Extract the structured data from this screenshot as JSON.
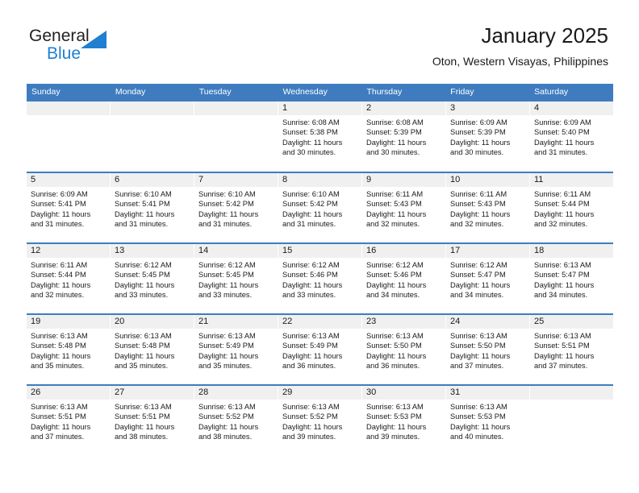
{
  "brand": {
    "name_part1": "General",
    "name_part2": "Blue",
    "triangle_color": "#1f7fd0",
    "text_color": "#231f20"
  },
  "header": {
    "title": "January 2025",
    "subtitle": "Oton, Western Visayas, Philippines"
  },
  "theme": {
    "header_blue": "#3f7cbf",
    "day_band_gray": "#f0f0f0",
    "text": "#1a1a1a"
  },
  "weekdays": [
    "Sunday",
    "Monday",
    "Tuesday",
    "Wednesday",
    "Thursday",
    "Friday",
    "Saturday"
  ],
  "weeks": [
    [
      {
        "empty": true
      },
      {
        "empty": true
      },
      {
        "empty": true
      },
      {
        "day": "1",
        "sunrise": "Sunrise: 6:08 AM",
        "sunset": "Sunset: 5:38 PM",
        "daylight1": "Daylight: 11 hours",
        "daylight2": "and 30 minutes."
      },
      {
        "day": "2",
        "sunrise": "Sunrise: 6:08 AM",
        "sunset": "Sunset: 5:39 PM",
        "daylight1": "Daylight: 11 hours",
        "daylight2": "and 30 minutes."
      },
      {
        "day": "3",
        "sunrise": "Sunrise: 6:09 AM",
        "sunset": "Sunset: 5:39 PM",
        "daylight1": "Daylight: 11 hours",
        "daylight2": "and 30 minutes."
      },
      {
        "day": "4",
        "sunrise": "Sunrise: 6:09 AM",
        "sunset": "Sunset: 5:40 PM",
        "daylight1": "Daylight: 11 hours",
        "daylight2": "and 31 minutes."
      }
    ],
    [
      {
        "day": "5",
        "sunrise": "Sunrise: 6:09 AM",
        "sunset": "Sunset: 5:41 PM",
        "daylight1": "Daylight: 11 hours",
        "daylight2": "and 31 minutes."
      },
      {
        "day": "6",
        "sunrise": "Sunrise: 6:10 AM",
        "sunset": "Sunset: 5:41 PM",
        "daylight1": "Daylight: 11 hours",
        "daylight2": "and 31 minutes."
      },
      {
        "day": "7",
        "sunrise": "Sunrise: 6:10 AM",
        "sunset": "Sunset: 5:42 PM",
        "daylight1": "Daylight: 11 hours",
        "daylight2": "and 31 minutes."
      },
      {
        "day": "8",
        "sunrise": "Sunrise: 6:10 AM",
        "sunset": "Sunset: 5:42 PM",
        "daylight1": "Daylight: 11 hours",
        "daylight2": "and 31 minutes."
      },
      {
        "day": "9",
        "sunrise": "Sunrise: 6:11 AM",
        "sunset": "Sunset: 5:43 PM",
        "daylight1": "Daylight: 11 hours",
        "daylight2": "and 32 minutes."
      },
      {
        "day": "10",
        "sunrise": "Sunrise: 6:11 AM",
        "sunset": "Sunset: 5:43 PM",
        "daylight1": "Daylight: 11 hours",
        "daylight2": "and 32 minutes."
      },
      {
        "day": "11",
        "sunrise": "Sunrise: 6:11 AM",
        "sunset": "Sunset: 5:44 PM",
        "daylight1": "Daylight: 11 hours",
        "daylight2": "and 32 minutes."
      }
    ],
    [
      {
        "day": "12",
        "sunrise": "Sunrise: 6:11 AM",
        "sunset": "Sunset: 5:44 PM",
        "daylight1": "Daylight: 11 hours",
        "daylight2": "and 32 minutes."
      },
      {
        "day": "13",
        "sunrise": "Sunrise: 6:12 AM",
        "sunset": "Sunset: 5:45 PM",
        "daylight1": "Daylight: 11 hours",
        "daylight2": "and 33 minutes."
      },
      {
        "day": "14",
        "sunrise": "Sunrise: 6:12 AM",
        "sunset": "Sunset: 5:45 PM",
        "daylight1": "Daylight: 11 hours",
        "daylight2": "and 33 minutes."
      },
      {
        "day": "15",
        "sunrise": "Sunrise: 6:12 AM",
        "sunset": "Sunset: 5:46 PM",
        "daylight1": "Daylight: 11 hours",
        "daylight2": "and 33 minutes."
      },
      {
        "day": "16",
        "sunrise": "Sunrise: 6:12 AM",
        "sunset": "Sunset: 5:46 PM",
        "daylight1": "Daylight: 11 hours",
        "daylight2": "and 34 minutes."
      },
      {
        "day": "17",
        "sunrise": "Sunrise: 6:12 AM",
        "sunset": "Sunset: 5:47 PM",
        "daylight1": "Daylight: 11 hours",
        "daylight2": "and 34 minutes."
      },
      {
        "day": "18",
        "sunrise": "Sunrise: 6:13 AM",
        "sunset": "Sunset: 5:47 PM",
        "daylight1": "Daylight: 11 hours",
        "daylight2": "and 34 minutes."
      }
    ],
    [
      {
        "day": "19",
        "sunrise": "Sunrise: 6:13 AM",
        "sunset": "Sunset: 5:48 PM",
        "daylight1": "Daylight: 11 hours",
        "daylight2": "and 35 minutes."
      },
      {
        "day": "20",
        "sunrise": "Sunrise: 6:13 AM",
        "sunset": "Sunset: 5:48 PM",
        "daylight1": "Daylight: 11 hours",
        "daylight2": "and 35 minutes."
      },
      {
        "day": "21",
        "sunrise": "Sunrise: 6:13 AM",
        "sunset": "Sunset: 5:49 PM",
        "daylight1": "Daylight: 11 hours",
        "daylight2": "and 35 minutes."
      },
      {
        "day": "22",
        "sunrise": "Sunrise: 6:13 AM",
        "sunset": "Sunset: 5:49 PM",
        "daylight1": "Daylight: 11 hours",
        "daylight2": "and 36 minutes."
      },
      {
        "day": "23",
        "sunrise": "Sunrise: 6:13 AM",
        "sunset": "Sunset: 5:50 PM",
        "daylight1": "Daylight: 11 hours",
        "daylight2": "and 36 minutes."
      },
      {
        "day": "24",
        "sunrise": "Sunrise: 6:13 AM",
        "sunset": "Sunset: 5:50 PM",
        "daylight1": "Daylight: 11 hours",
        "daylight2": "and 37 minutes."
      },
      {
        "day": "25",
        "sunrise": "Sunrise: 6:13 AM",
        "sunset": "Sunset: 5:51 PM",
        "daylight1": "Daylight: 11 hours",
        "daylight2": "and 37 minutes."
      }
    ],
    [
      {
        "day": "26",
        "sunrise": "Sunrise: 6:13 AM",
        "sunset": "Sunset: 5:51 PM",
        "daylight1": "Daylight: 11 hours",
        "daylight2": "and 37 minutes."
      },
      {
        "day": "27",
        "sunrise": "Sunrise: 6:13 AM",
        "sunset": "Sunset: 5:51 PM",
        "daylight1": "Daylight: 11 hours",
        "daylight2": "and 38 minutes."
      },
      {
        "day": "28",
        "sunrise": "Sunrise: 6:13 AM",
        "sunset": "Sunset: 5:52 PM",
        "daylight1": "Daylight: 11 hours",
        "daylight2": "and 38 minutes."
      },
      {
        "day": "29",
        "sunrise": "Sunrise: 6:13 AM",
        "sunset": "Sunset: 5:52 PM",
        "daylight1": "Daylight: 11 hours",
        "daylight2": "and 39 minutes."
      },
      {
        "day": "30",
        "sunrise": "Sunrise: 6:13 AM",
        "sunset": "Sunset: 5:53 PM",
        "daylight1": "Daylight: 11 hours",
        "daylight2": "and 39 minutes."
      },
      {
        "day": "31",
        "sunrise": "Sunrise: 6:13 AM",
        "sunset": "Sunset: 5:53 PM",
        "daylight1": "Daylight: 11 hours",
        "daylight2": "and 40 minutes."
      },
      {
        "empty": true
      }
    ]
  ]
}
